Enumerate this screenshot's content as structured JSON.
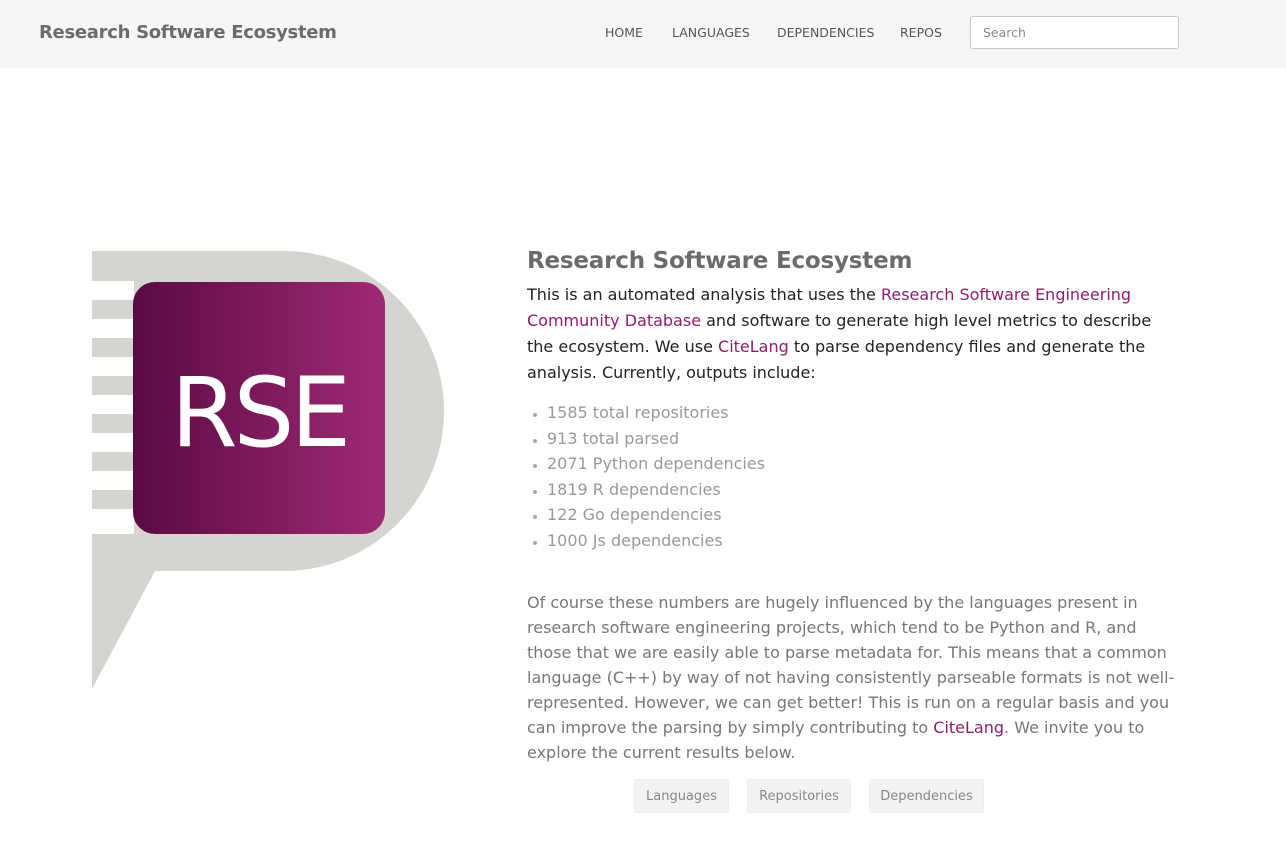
{
  "navbar": {
    "brand": "Research Software Ecosystem",
    "links": [
      "HOME",
      "LANGUAGES",
      "DEPENDENCIES",
      "REPOS"
    ],
    "search_placeholder": "Search"
  },
  "logo": {
    "text": "RSE",
    "colors": {
      "bubble": "#d6d4d1",
      "gradient_start": "#5a0a42",
      "gradient_end": "#9e2a74"
    }
  },
  "main": {
    "title": "Research Software Ecosystem",
    "intro": {
      "text1": "This is an automated analysis that uses the ",
      "link1": "Research Software Engineering Community Database",
      "text2": " and software to generate high level metrics to describe the ecosystem. We use ",
      "link2": "CiteLang",
      "text3": " to parse dependency files and generate the analysis. Currently, outputs include:"
    },
    "stats": [
      "1585 total repositories",
      "913 total parsed",
      "2071 Python dependencies",
      "1819 R dependencies",
      "122 Go dependencies",
      "1000 Js dependencies"
    ],
    "paragraph": {
      "text1": "Of course these numbers are hugely influenced by the languages present in research software engineering projects, which tend to be Python and R, and those that we are easily able to parse metadata for. This means that a common language (C++) by way of not having consistently parseable formats is not well-represented. However, we can get better! This is run on a regular basis and you can improve the parsing by simply contributing to ",
      "link": "CiteLang",
      "text2": ". We invite you to explore the current results below."
    },
    "buttons": [
      "Languages",
      "Repositories",
      "Dependencies"
    ]
  },
  "colors": {
    "accent": "#8e1e6b",
    "navbar_bg": "#f6f6f6"
  }
}
